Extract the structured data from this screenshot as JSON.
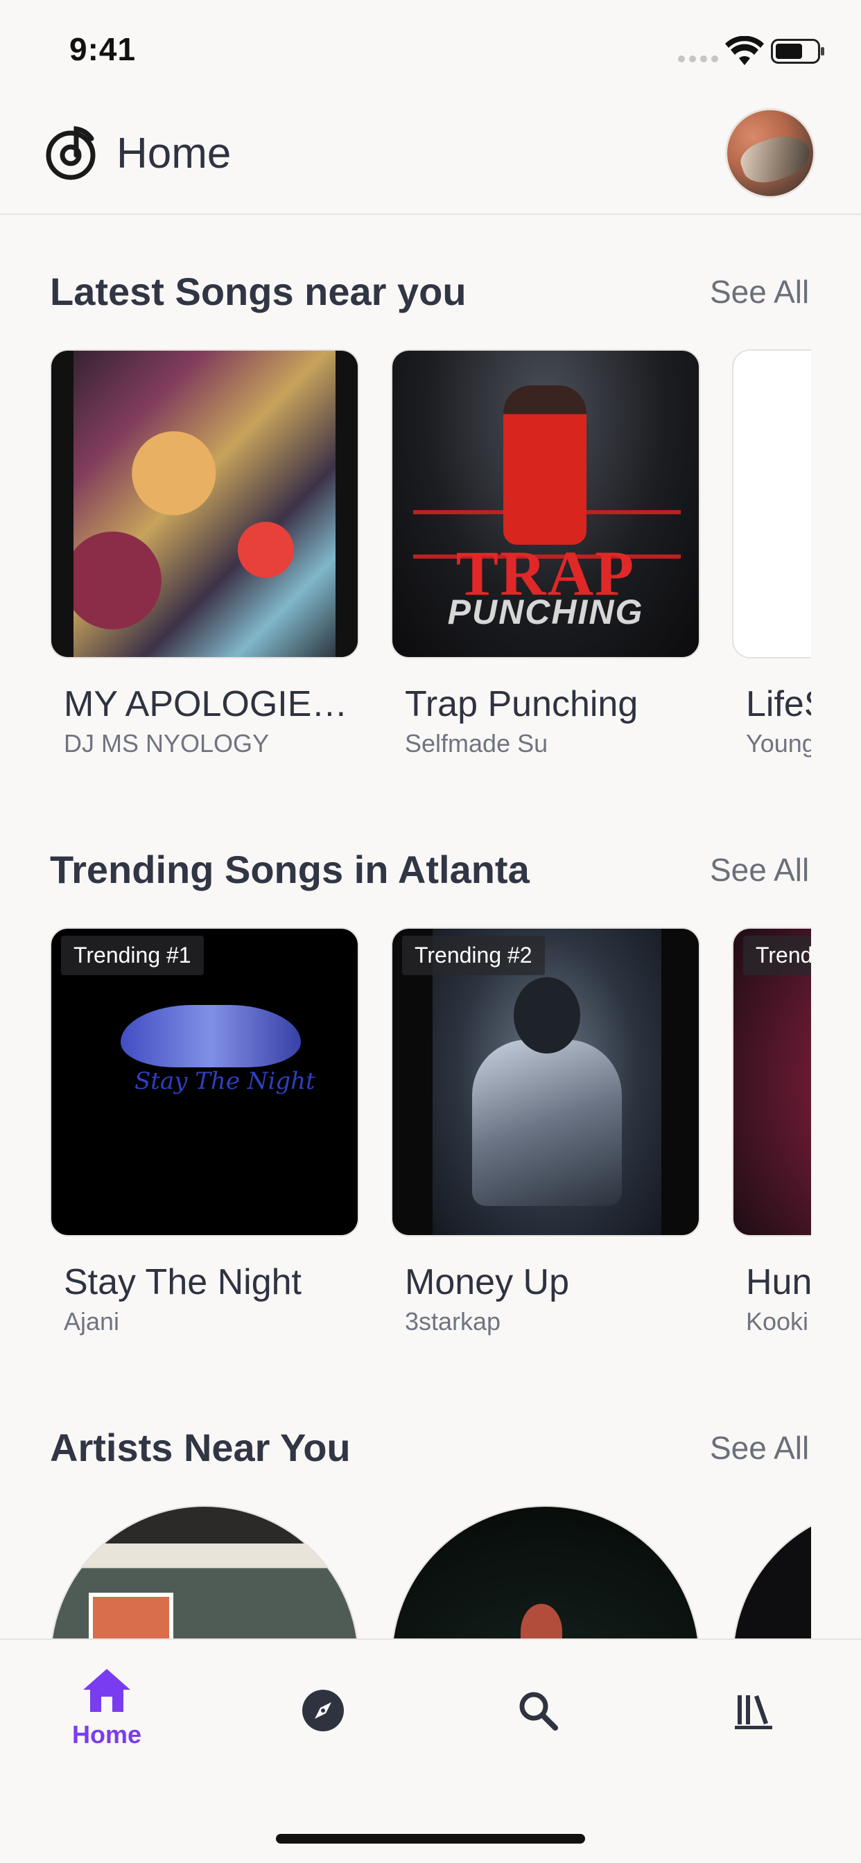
{
  "status_bar": {
    "time": "9:41"
  },
  "header": {
    "title": "Home"
  },
  "sections": [
    {
      "title": "Latest Songs near you",
      "see_all": "See All",
      "items": [
        {
          "title": "MY APOLOGIES...",
          "artist": "DJ MS NYOLOGY"
        },
        {
          "title": "Trap Punching",
          "artist": "Selfmade Su",
          "cover_text": [
            "TRAP",
            "PUNCHING"
          ]
        },
        {
          "title": "LifeS",
          "artist": "Young"
        }
      ]
    },
    {
      "title": "Trending Songs in Atlanta",
      "see_all": "See All",
      "items": [
        {
          "badge": "Trending #1",
          "title": "Stay The Night",
          "artist": "Ajani",
          "cover_text": "Stay The Night"
        },
        {
          "badge": "Trending #2",
          "title": "Money Up",
          "artist": "3starkap"
        },
        {
          "badge": "Trendi",
          "title": "Hun",
          "artist": "Kooki"
        }
      ]
    },
    {
      "title": "Artists Near You",
      "see_all": "See All"
    }
  ],
  "bottom_nav": {
    "items": [
      {
        "label": "Home",
        "icon": "home-icon",
        "active": true
      },
      {
        "label": "",
        "icon": "compass-icon"
      },
      {
        "label": "",
        "icon": "search-icon"
      },
      {
        "label": "",
        "icon": "library-icon"
      }
    ],
    "active_color": "#7a3cf0"
  }
}
